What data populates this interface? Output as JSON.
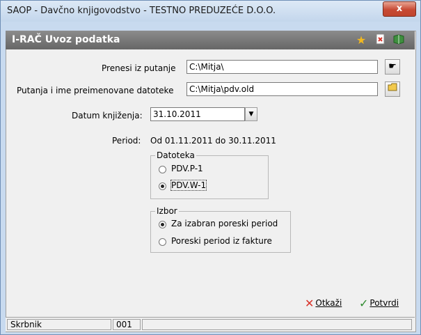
{
  "window": {
    "title": "SAOP -  Davčno knjigovodstvo - TESTNO PREDUZEĆE D.O.O.",
    "close_label": "x"
  },
  "header": {
    "title": "I-RAČ Uvoz podatka"
  },
  "form": {
    "source_path_label": "Prenesi iz putanje",
    "source_path_value": "C:\\Mitja\\",
    "renamed_path_label": "Putanja i ime preimenovane datoteke",
    "renamed_path_value": "C:\\Mitja\\pdv.old",
    "date_label": "Datum knjiženja:",
    "date_value": "31.10.2011",
    "period_label": "Period:",
    "period_value": "Od 01.11.2011 do 30.11.2011"
  },
  "file_group": {
    "title": "Datoteka",
    "options": [
      {
        "label": "PDV.P-1",
        "selected": false
      },
      {
        "label": "PDV.W-1",
        "selected": true
      }
    ]
  },
  "choice_group": {
    "title": "Izbor",
    "options": [
      {
        "label": "Za izabran poreski period",
        "selected": true
      },
      {
        "label": "Poreski period iz fakture",
        "selected": false
      }
    ]
  },
  "actions": {
    "cancel_label": "Otkaži",
    "confirm_label": "Potvrdi"
  },
  "statusbar": {
    "user": "Skrbnik",
    "code": "001"
  },
  "icons": {
    "close": "close-icon",
    "favorite": "star-icon",
    "exit": "exit-icon",
    "help": "book-icon",
    "browse": "folder-icon",
    "cancel": "x-icon",
    "confirm": "check-icon"
  },
  "colors": {
    "accent_star": "#f2b81f",
    "cancel": "#d8332a",
    "confirm": "#2e8b2e",
    "header_bg": "#7a7a7a"
  }
}
